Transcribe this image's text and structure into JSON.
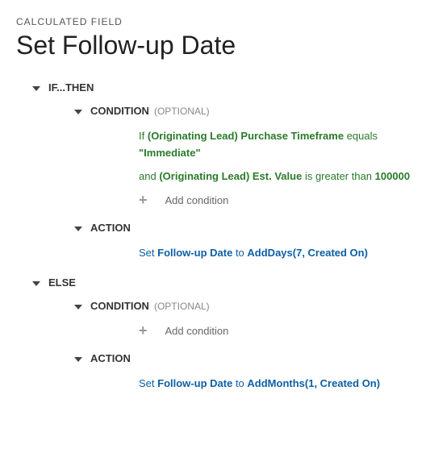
{
  "breadcrumb": "CALCULATED FIELD",
  "title": "Set Follow-up Date",
  "ifthen": {
    "label": "IF...THEN",
    "condition": {
      "label": "CONDITION",
      "optional": "(OPTIONAL)",
      "rows": [
        {
          "prefix": "If",
          "field": "(Originating Lead) Purchase Timeframe",
          "op": "equals",
          "value": "\"Immediate\""
        },
        {
          "prefix": "and",
          "field": "(Originating Lead) Est. Value",
          "op": "is greater than",
          "value": "100000"
        }
      ],
      "add": "Add condition"
    },
    "action": {
      "label": "ACTION",
      "verb": "Set",
      "field": "Follow-up Date",
      "to": "to",
      "func": "AddDays(7, Created On)"
    }
  },
  "else": {
    "label": "ELSE",
    "condition": {
      "label": "CONDITION",
      "optional": "(OPTIONAL)",
      "add": "Add condition"
    },
    "action": {
      "label": "ACTION",
      "verb": "Set",
      "field": "Follow-up Date",
      "to": "to",
      "func": "AddMonths(1, Created On)"
    }
  }
}
